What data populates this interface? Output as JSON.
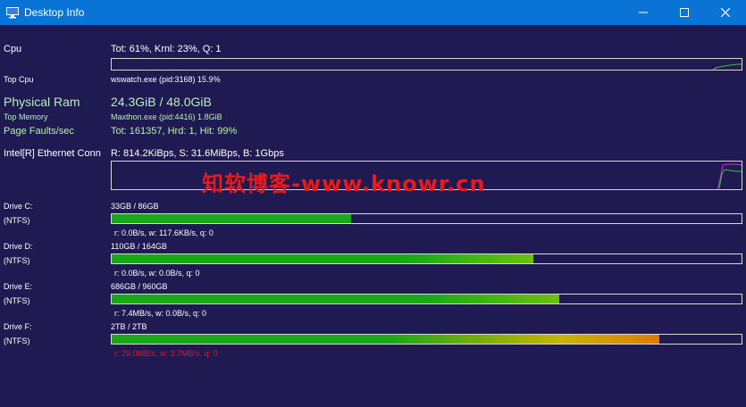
{
  "window": {
    "title": "Desktop Info",
    "minimize": "—",
    "maximize": "☐",
    "close": "✕"
  },
  "cpu": {
    "label": "Cpu",
    "value": "Tot: 61%, Krnl: 23%, Q: 1",
    "top_label": "Top Cpu",
    "top_value": "wswatch.exe (pid:3168) 15.9%"
  },
  "memory": {
    "label": "Physical Ram",
    "value": "24.3GiB / 48.0GiB",
    "top_label": "Top Memory",
    "top_value": "Maxthon.exe (pid:4416) 1.8GiB",
    "faults_label": "Page Faults/sec",
    "faults_value": "Tot: 161357, Hrd: 1, Hit: 99%"
  },
  "network": {
    "label": "Intel[R] Ethernet Conn",
    "value": "R: 814.2KiBps, S: 31.6MiBps, B: 1Gbps"
  },
  "drives": [
    {
      "name": "Drive C:",
      "fs": "(NTFS)",
      "usage": "33GB / 86GB",
      "fill": 0.38,
      "io": "r: 0.0B/s, w: 117.6KB/s, q: 0",
      "io_alert": false
    },
    {
      "name": "Drive D:",
      "fs": "(NTFS)",
      "usage": "110GB / 164GB",
      "fill": 0.67,
      "io": "r: 0.0B/s, w: 0.0B/s, q: 0",
      "io_alert": false
    },
    {
      "name": "Drive E:",
      "fs": "(NTFS)",
      "usage": "686GB / 960GB",
      "fill": 0.71,
      "io": "r: 7.4MB/s, w: 0.0B/s, q: 0",
      "io_alert": false
    },
    {
      "name": "Drive F:",
      "fs": "(NTFS)",
      "usage": "2TB / 2TB",
      "fill": 0.87,
      "io": "r: 29.0MB/s, w: 3.7MB/s, q: 0",
      "io_alert": true
    }
  ],
  "watermark": "知软博客-www.knowr.cn",
  "colors": {
    "titlebar": "#0a74d6",
    "background": "#1f1a52",
    "bar_green": "#18a818",
    "bar_yellow": "#c8b400",
    "bar_orange": "#e07a00",
    "alert_red": "#d81d2c"
  }
}
